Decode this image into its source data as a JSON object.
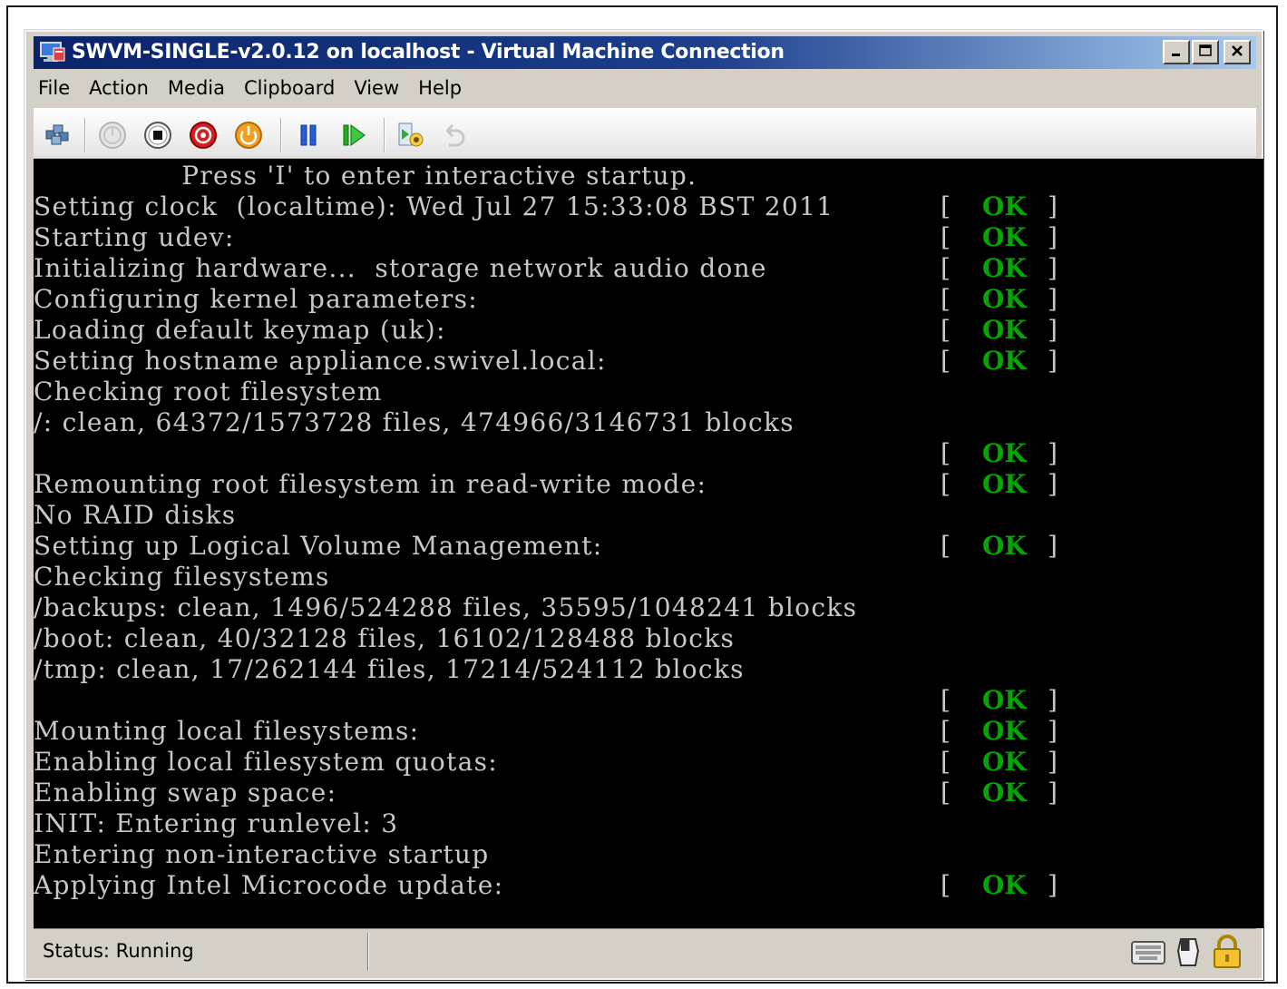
{
  "window": {
    "title": "SWVM-SINGLE-v2.0.12 on localhost - Virtual Machine Connection",
    "controls": {
      "minimize": "minimize-icon",
      "maximize": "maximize-icon",
      "close": "close-icon"
    }
  },
  "menu": {
    "items": [
      {
        "label": "File"
      },
      {
        "label": "Action"
      },
      {
        "label": "Media"
      },
      {
        "label": "Clipboard"
      },
      {
        "label": "View"
      },
      {
        "label": "Help"
      }
    ]
  },
  "toolbar": {
    "buttons": [
      {
        "icon": "ctrl-alt-del-icon",
        "enabled": true
      },
      {
        "icon": "start-icon",
        "enabled": false
      },
      {
        "icon": "turn-off-icon",
        "enabled": true
      },
      {
        "icon": "shut-down-icon",
        "enabled": true
      },
      {
        "icon": "save-state-icon",
        "enabled": true
      },
      {
        "icon": "pause-icon",
        "enabled": true
      },
      {
        "icon": "reset-icon",
        "enabled": true
      },
      {
        "icon": "snapshot-icon",
        "enabled": true
      },
      {
        "icon": "revert-icon",
        "enabled": false
      }
    ]
  },
  "console": {
    "lines": [
      "                Press 'I' to enter interactive startup.",
      "Setting clock  (localtime): Wed Jul 27 15:33:08 BST 2011",
      "Starting udev:",
      "Initializing hardware...  storage network audio done",
      "Configuring kernel parameters:",
      "Loading default keymap (uk):",
      "Setting hostname appliance.swivel.local:",
      "Checking root filesystem",
      "/: clean, 64372/1573728 files, 474966/3146731 blocks",
      "",
      "Remounting root filesystem in read-write mode:",
      "No RAID disks",
      "Setting up Logical Volume Management:",
      "Checking filesystems",
      "/backups: clean, 1496/524288 files, 35595/1048241 blocks",
      "/boot: clean, 40/32128 files, 16102/128488 blocks",
      "/tmp: clean, 17/262144 files, 17214/524112 blocks",
      "",
      "Mounting local filesystems:",
      "Enabling local filesystem quotas:",
      "Enabling swap space:",
      "INIT: Entering runlevel: 3",
      "Entering non-interactive startup",
      "Applying Intel Microcode update:"
    ],
    "ok_line_indexes": [
      1,
      2,
      3,
      4,
      5,
      6,
      9,
      10,
      12,
      17,
      18,
      19,
      20,
      23
    ],
    "ok_open": "[",
    "ok_text": "OK",
    "ok_close": "]",
    "ok_color": "#00a800",
    "text_color": "#c8c8c8",
    "background": "#000000"
  },
  "statusbar": {
    "status": "Status: Running",
    "icons": [
      "keyboard-icon",
      "mouse-icon",
      "lock-icon"
    ]
  }
}
